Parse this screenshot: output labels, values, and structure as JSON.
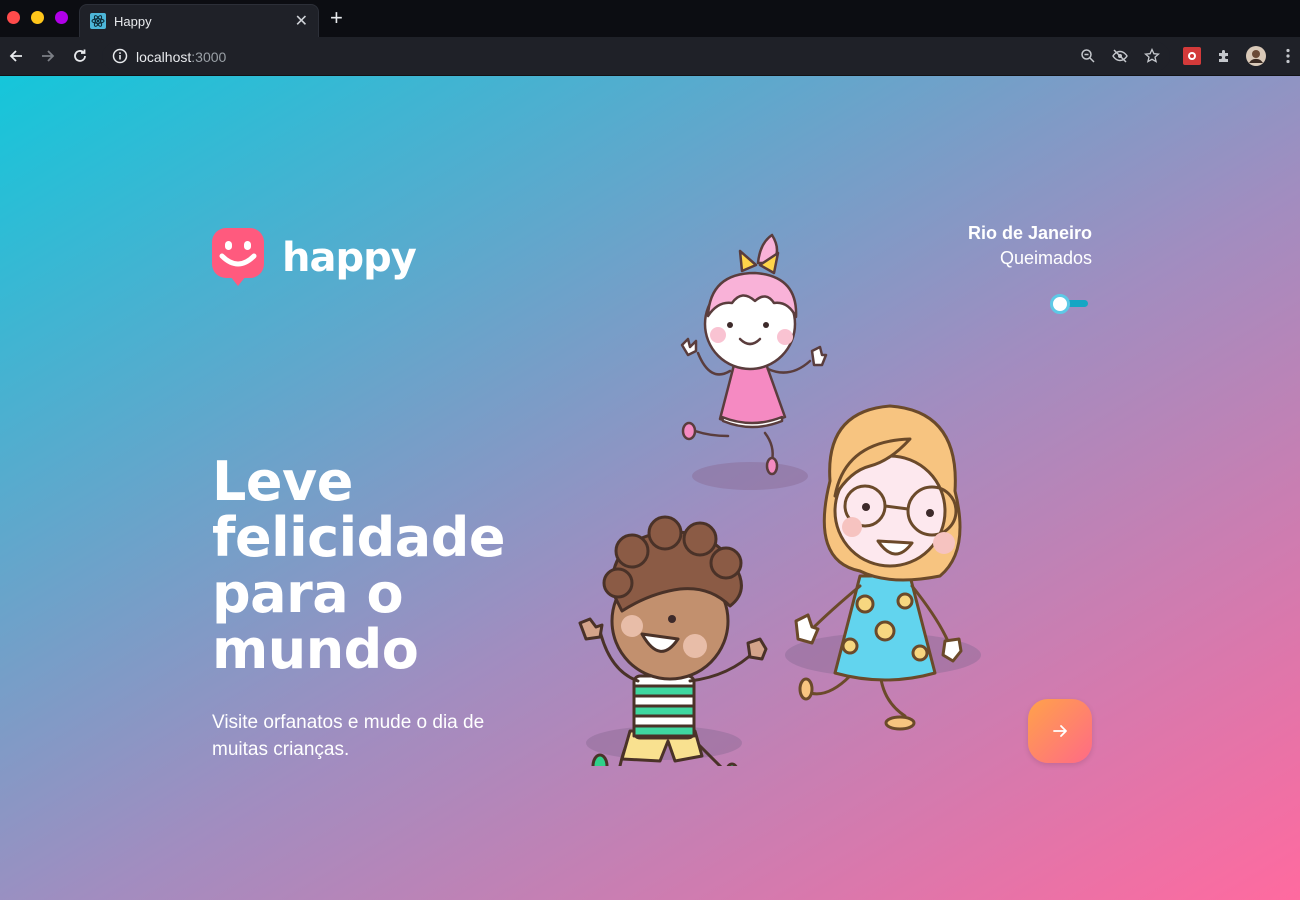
{
  "browser": {
    "tab_title": "Happy",
    "url_host": "localhost",
    "url_port": ":3000",
    "icons": [
      "back-icon",
      "forward-icon",
      "reload-icon",
      "info-icon",
      "zoom-out-icon",
      "eye-off-icon",
      "star-icon",
      "extension-icon",
      "puzzle-icon",
      "avatar",
      "menu-icon"
    ]
  },
  "landing": {
    "logo_text": "happy",
    "location": {
      "city": "Rio de Janeiro",
      "district": "Queimados"
    },
    "headline": "Leve felicidade para o mundo",
    "subline": "Visite orfanatos e mude o dia de muitas crianças.",
    "enter_icon": "arrow-right-icon"
  },
  "colors": {
    "gradient_start": "#15c6da",
    "gradient_end": "#ff6a9f",
    "logo_pink": "#ff5a7e",
    "button_orange": "#ffa24a",
    "button_pink": "#ff6a86"
  }
}
